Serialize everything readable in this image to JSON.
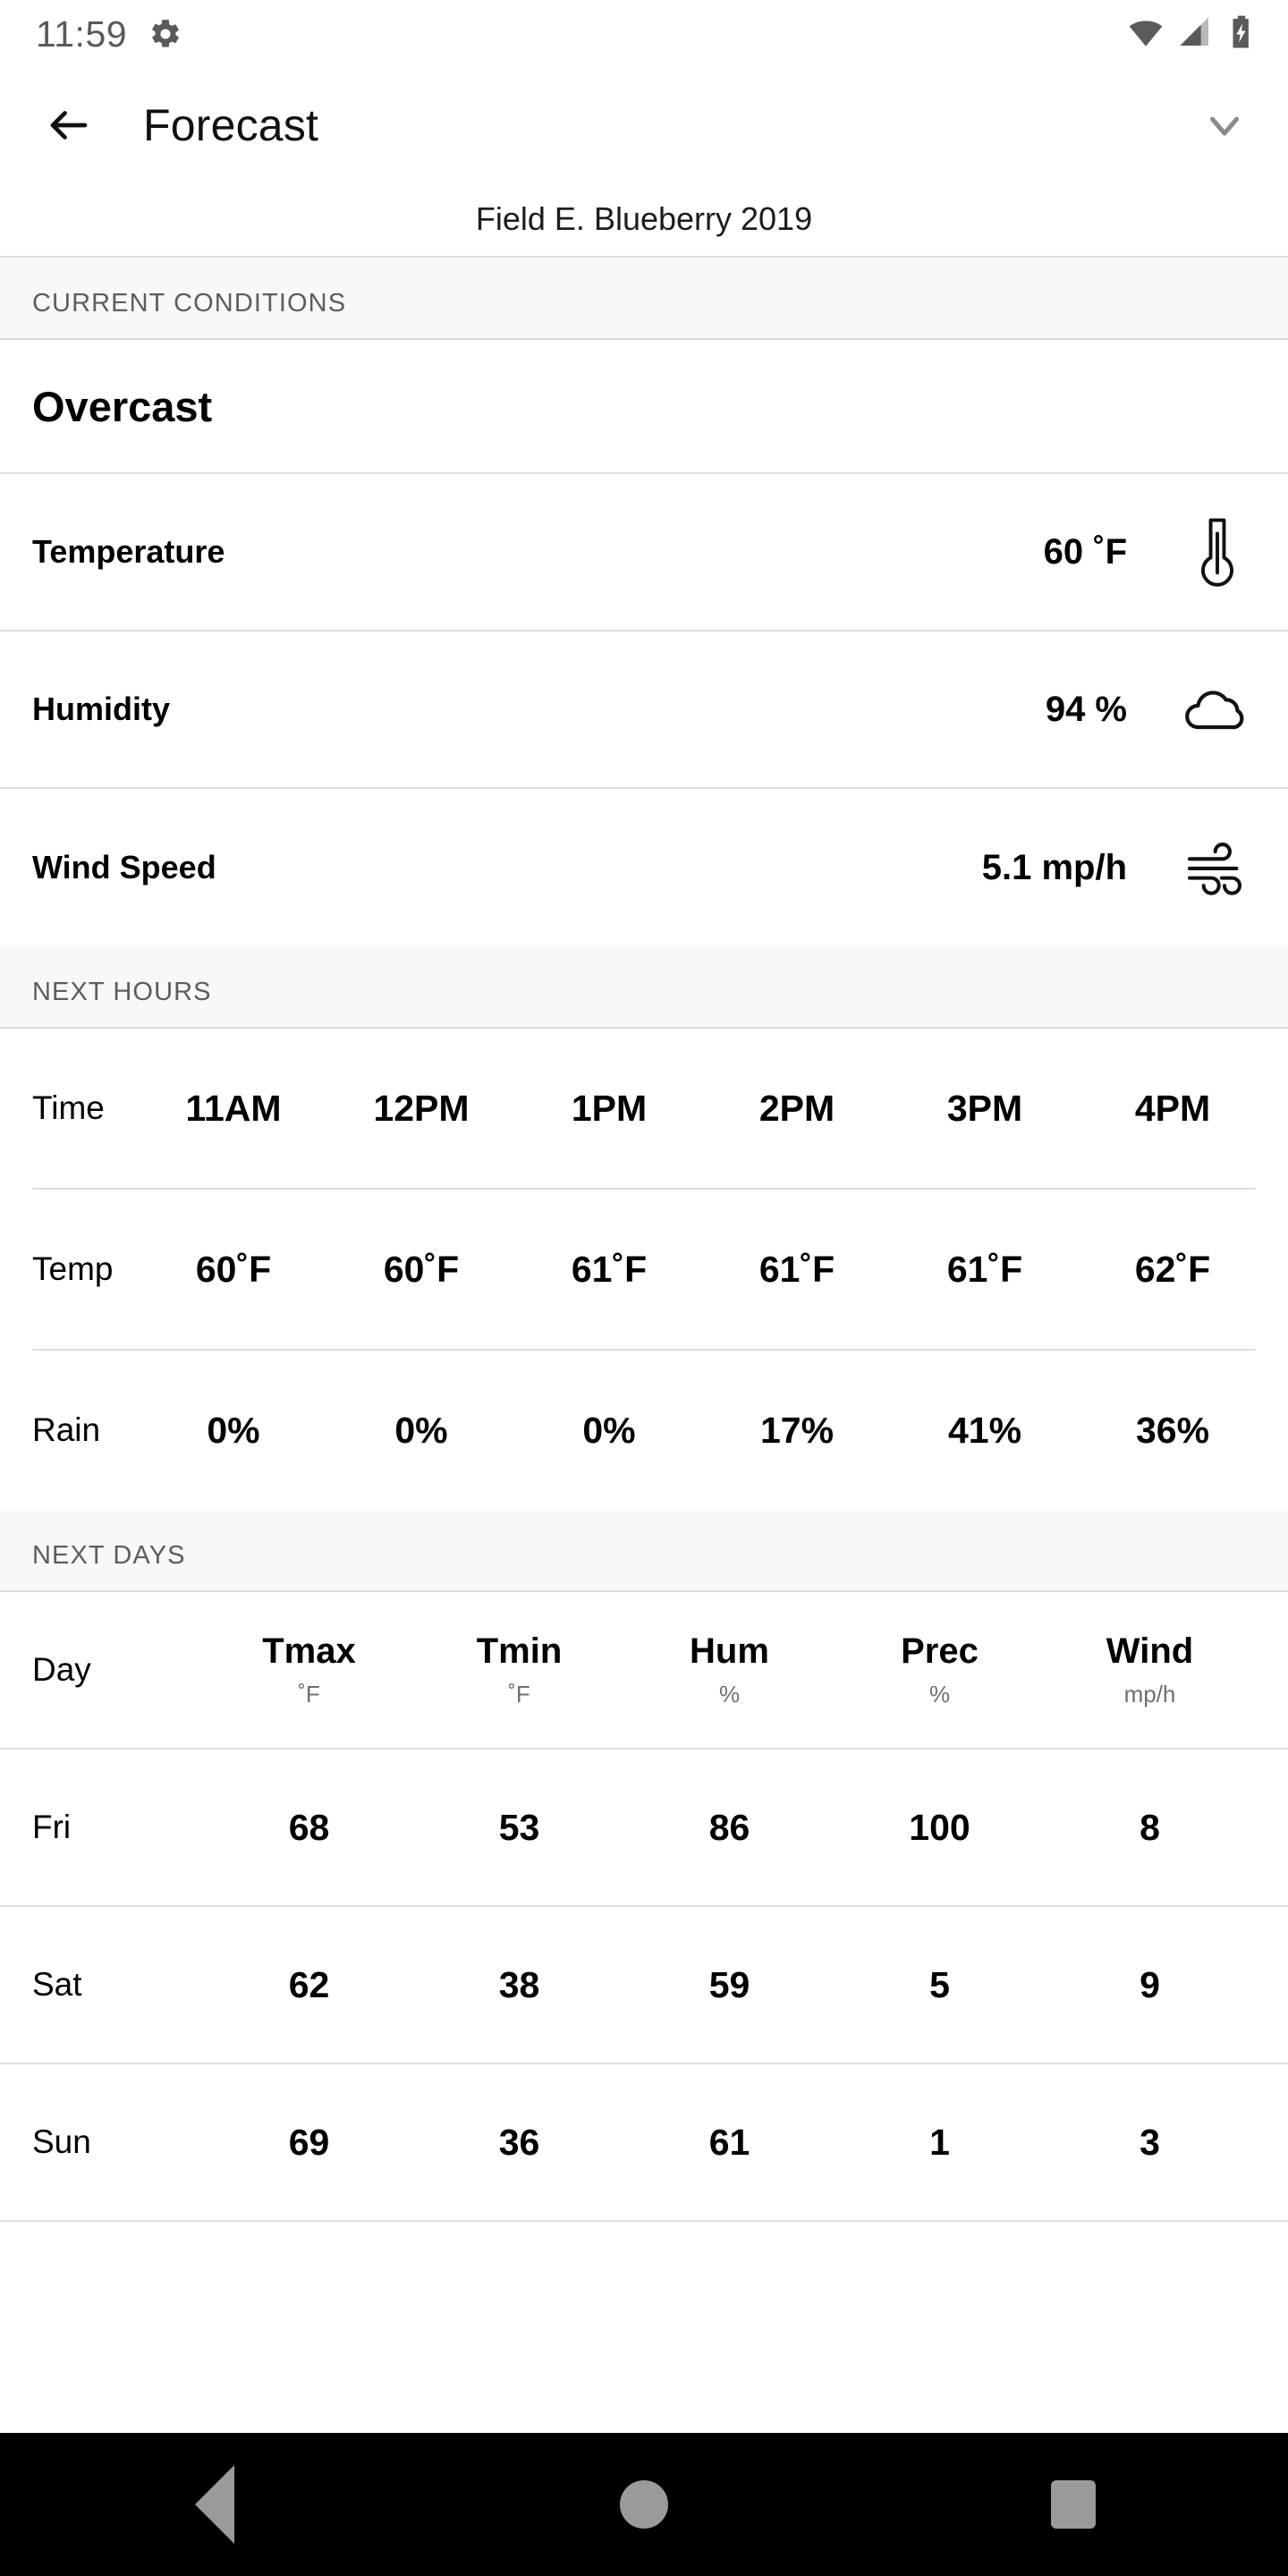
{
  "status_bar": {
    "time": "11:59",
    "icons": [
      "gear-icon",
      "wifi-icon",
      "cellular-signal-icon",
      "battery-charging-icon"
    ]
  },
  "app_bar": {
    "back_label": "back-arrow-icon",
    "title": "Forecast",
    "dropdown_label": "chevron-down-icon"
  },
  "subtitle": "Field E. Blueberry 2019",
  "current_conditions": {
    "section_label": "CURRENT CONDITIONS",
    "condition": "Overcast",
    "metrics": [
      {
        "name": "Temperature",
        "value": "60 ˚F",
        "icon": "thermometer-icon"
      },
      {
        "name": "Humidity",
        "value": "94 %",
        "icon": "cloud-icon"
      },
      {
        "name": "Wind Speed",
        "value": "5.1 mp/h",
        "icon": "wind-icon"
      }
    ]
  },
  "next_hours": {
    "section_label": "NEXT HOURS",
    "row_labels": {
      "time": "Time",
      "temp": "Temp",
      "rain": "Rain"
    },
    "times": [
      "11AM",
      "12PM",
      "1PM",
      "2PM",
      "3PM",
      "4PM"
    ],
    "temps": [
      "60˚F",
      "60˚F",
      "61˚F",
      "61˚F",
      "61˚F",
      "62˚F"
    ],
    "rain": [
      "0%",
      "0%",
      "0%",
      "17%",
      "41%",
      "36%"
    ]
  },
  "next_days": {
    "section_label": "NEXT DAYS",
    "day_header": "Day",
    "columns": [
      {
        "title": "Tmax",
        "unit": "˚F"
      },
      {
        "title": "Tmin",
        "unit": "˚F"
      },
      {
        "title": "Hum",
        "unit": "%"
      },
      {
        "title": "Prec",
        "unit": "%"
      },
      {
        "title": "Wind",
        "unit": "mp/h"
      }
    ],
    "rows": [
      {
        "day": "Fri",
        "values": [
          "68",
          "53",
          "86",
          "100",
          "8"
        ]
      },
      {
        "day": "Sat",
        "values": [
          "62",
          "38",
          "59",
          "5",
          "9"
        ]
      },
      {
        "day": "Sun",
        "values": [
          "69",
          "36",
          "61",
          "1",
          "3"
        ]
      }
    ]
  },
  "nav_bar": {
    "back": "nav-back-triangle",
    "home": "nav-home-circle",
    "recents": "nav-recents-square"
  },
  "colors": {
    "background": "#ffffff",
    "section_bg": "#f8f8f8",
    "divider": "#dedede",
    "text_primary": "#000000",
    "text_muted": "#5d5d5d",
    "nav_bar_bg": "#000000",
    "nav_icon": "#9a9a9a"
  }
}
